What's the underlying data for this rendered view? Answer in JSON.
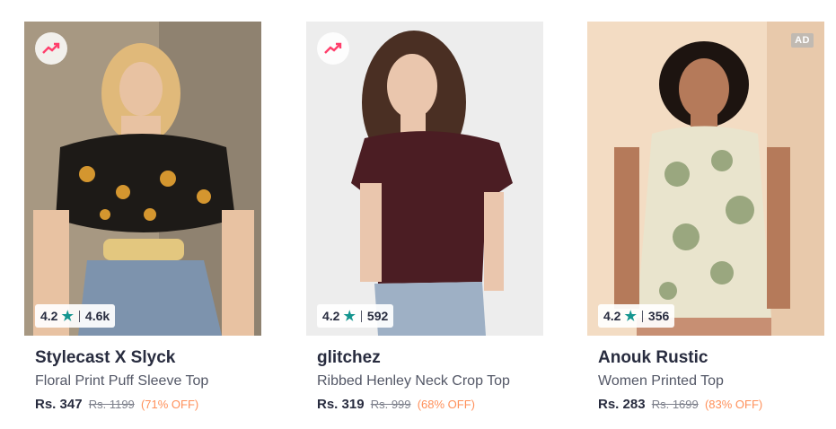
{
  "products": [
    {
      "brand": "Stylecast X Slyck",
      "name": "Floral Print Puff Sleeve Top",
      "price": "Rs. 347",
      "mrp": "Rs. 1199",
      "discount": "(71% OFF)",
      "rating": "4.2",
      "rating_count": "4.6k",
      "badge_icon": "trending-icon"
    },
    {
      "brand": "glitchez",
      "name": "Ribbed Henley Neck Crop Top",
      "price": "Rs. 319",
      "mrp": "Rs. 999",
      "discount": "(68% OFF)",
      "rating": "4.2",
      "rating_count": "592",
      "badge_icon": "trending-icon"
    },
    {
      "brand": "Anouk Rustic",
      "name": "Women Printed Top",
      "price": "Rs. 283",
      "mrp": "Rs. 1699",
      "discount": "(83% OFF)",
      "rating": "4.2",
      "rating_count": "356",
      "ad_label": "AD"
    }
  ],
  "colors": {
    "star": "#14958f",
    "discount": "#ff905a",
    "trend": "#ff3f6c"
  }
}
